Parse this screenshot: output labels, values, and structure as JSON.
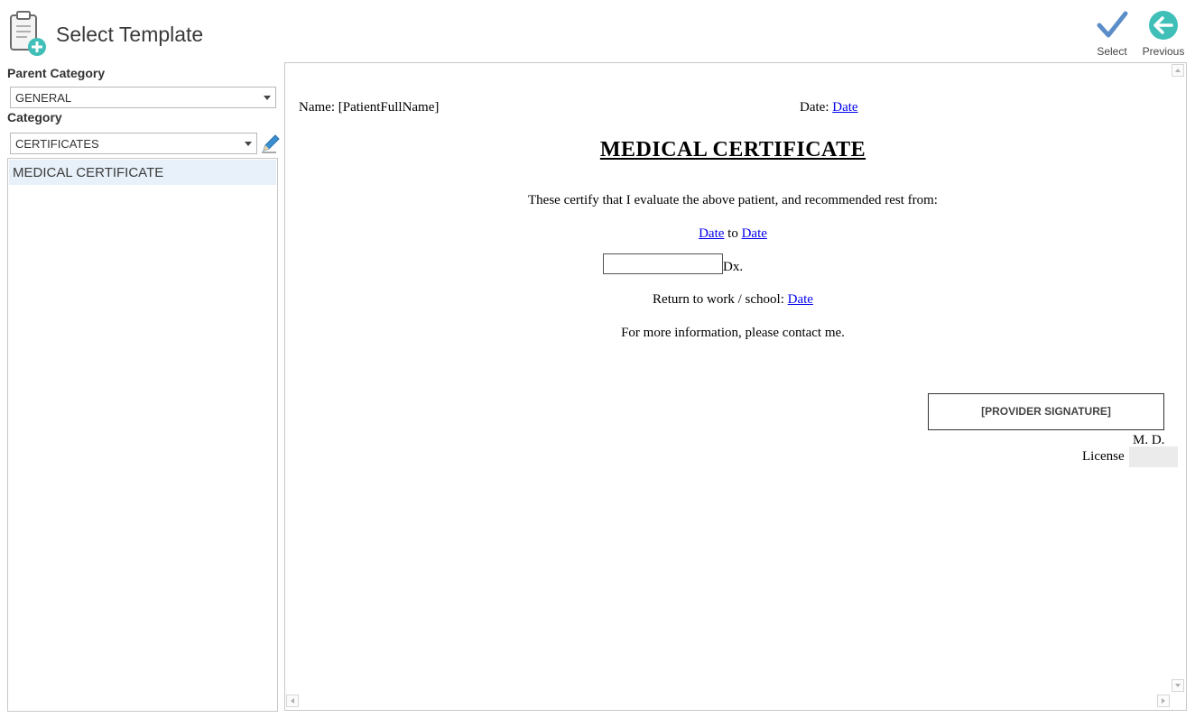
{
  "header": {
    "title": "Select Template",
    "app_icon": "clipboard-add-icon",
    "select_label": "Select",
    "previous_label": "Previous",
    "select_icon": "checkmark-icon",
    "previous_icon": "arrow-left-circle-icon"
  },
  "sidebar": {
    "parent_category_label": "Parent Category",
    "parent_category_value": "GENERAL",
    "category_label": "Category",
    "category_value": "CERTIFICATES",
    "edit_icon": "pencil-icon",
    "templates": [
      {
        "label": "MEDICAL CERTIFICATE",
        "selected": true
      }
    ]
  },
  "preview": {
    "name_line": "Name: [PatientFullName]",
    "date_label": "Date: ",
    "date_link": "Date",
    "title": "MEDICAL CERTIFICATE",
    "certify_text": "These certify that I evaluate the above patient, and recommended rest from:",
    "range_from": "Date",
    "range_to_word": " to ",
    "range_to": "Date",
    "dx_label": "Dx.",
    "return_label": "Return to work / school: ",
    "return_date": "Date",
    "more_info": "For more information, please contact me.",
    "signature": "[PROVIDER SIGNATURE]",
    "md": "M. D.",
    "license_label": "License"
  },
  "colors": {
    "accent_teal": "#3fbfb8",
    "check_blue": "#5b8ec9",
    "link_blue": "#0000ee",
    "selected_bg": "#e8f1fa"
  }
}
